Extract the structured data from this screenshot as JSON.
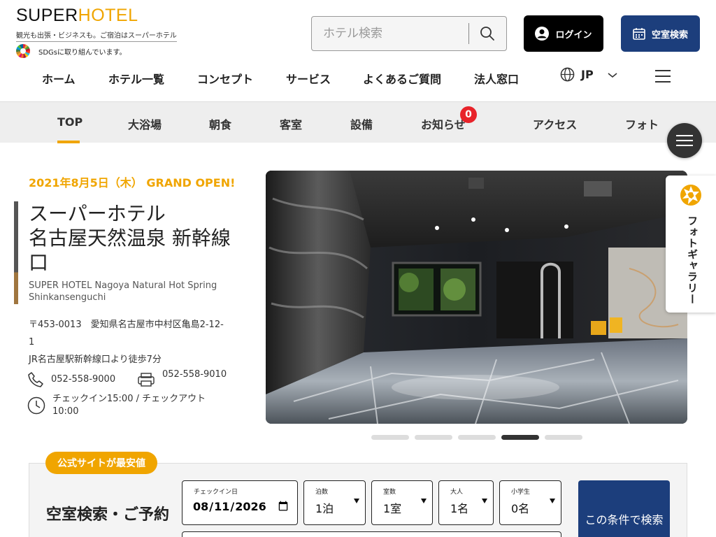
{
  "brand": {
    "logo_super": "SUPER",
    "logo_hotel": "HOTEL",
    "tagline": "観光も出張・ビジネスも。ご宿泊はスーパーホテル",
    "sdgs": "SDGsに取り組んでいます。"
  },
  "header": {
    "search_placeholder": "ホテル検索",
    "login_label": "ログイン",
    "availability_label": "空室検索"
  },
  "main_nav": {
    "items": [
      "ホーム",
      "ホテル一覧",
      "コンセプト",
      "サービス",
      "よくあるご質問",
      "法人窓口"
    ],
    "language": "JP"
  },
  "sub_nav": {
    "items": [
      "TOP",
      "大浴場",
      "朝食",
      "客室",
      "設備",
      "お知らせ",
      "アクセス",
      "フォト"
    ],
    "active": "TOP",
    "notice_count": "0"
  },
  "hotel": {
    "open_date": "2021年8月5日（木） GRAND OPEN!",
    "name": "スーパーホテル\n名古屋天然温泉 新幹線口",
    "name_en": "SUPER HOTEL Nagoya Natural Hot Spring Shinkansenguchi",
    "address": "〒453-0013　愛知県名古屋市中村区亀島2-12-1",
    "access": "JR名古屋駅新幹線口より徒歩7分",
    "tel": "052-558-9000",
    "fax": "052-558-9010",
    "checkin": "チェックイン15:00 / チェックアウト10:00"
  },
  "gallery": {
    "label": "フォトギャラリー",
    "slide_count": 5,
    "active_slide": 4
  },
  "booking": {
    "badge": "公式サイトが最安値",
    "title": "空室検索・ご予約",
    "checkin_label": "チェックイン日",
    "checkin_value": "2026-08-11",
    "nights_label": "泊数",
    "nights_value": "1泊",
    "rooms_label": "室数",
    "rooms_value": "1室",
    "adults_label": "大人",
    "adults_value": "1名",
    "children_label": "小学生",
    "children_value": "0名",
    "search_button": "この条件で検索"
  },
  "colors": {
    "accent": "#f0a500",
    "navy": "#1c3e7c",
    "badge_red": "#e8232a"
  }
}
